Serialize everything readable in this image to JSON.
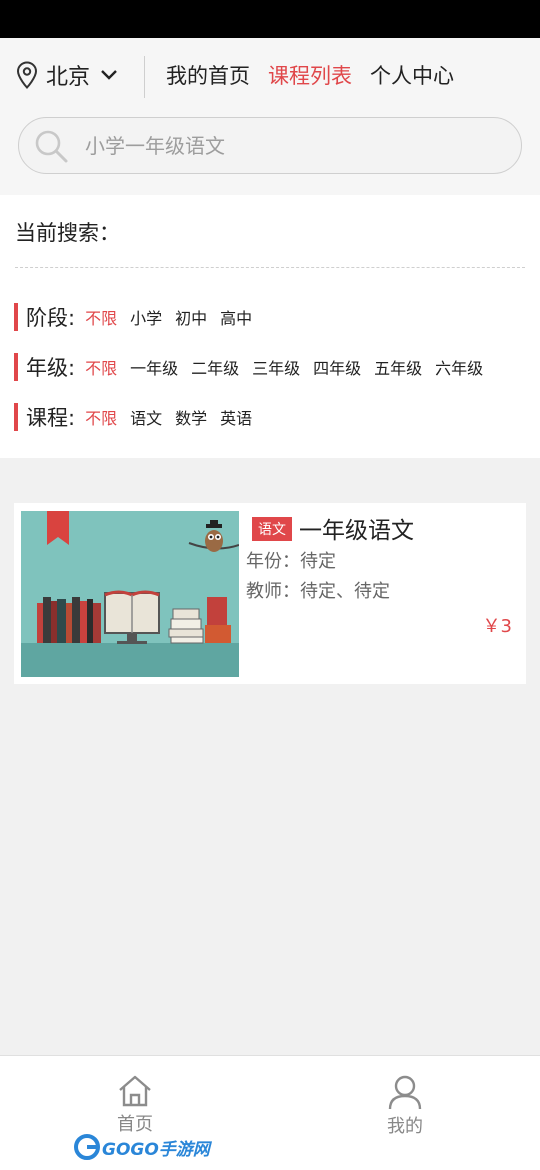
{
  "header": {
    "location": "北京",
    "nav": [
      {
        "label": "我的首页",
        "active": false
      },
      {
        "label": "课程列表",
        "active": true
      },
      {
        "label": "个人中心",
        "active": false
      }
    ]
  },
  "search": {
    "placeholder": "小学一年级语文"
  },
  "filter": {
    "current_label": "当前搜索：",
    "rows": [
      {
        "label": "阶段:",
        "options": [
          "不限",
          "小学",
          "初中",
          "高中"
        ]
      },
      {
        "label": "年级:",
        "options": [
          "不限",
          "一年级",
          "二年级",
          "三年级",
          "四年级",
          "五年级",
          "六年级"
        ]
      },
      {
        "label": "课程:",
        "options": [
          "不限",
          "语文",
          "数学",
          "英语"
        ]
      }
    ]
  },
  "course": {
    "tag": "语文",
    "title": "一年级语文",
    "year": "年份：待定",
    "teacher": "教师：待定、待定",
    "price": "￥3"
  },
  "tabbar": {
    "home": "首页",
    "mine": "我的"
  },
  "watermark": "GOGO手游网",
  "colors": {
    "accent": "#e0474a",
    "thumb_bg": "#7fc3bd"
  }
}
